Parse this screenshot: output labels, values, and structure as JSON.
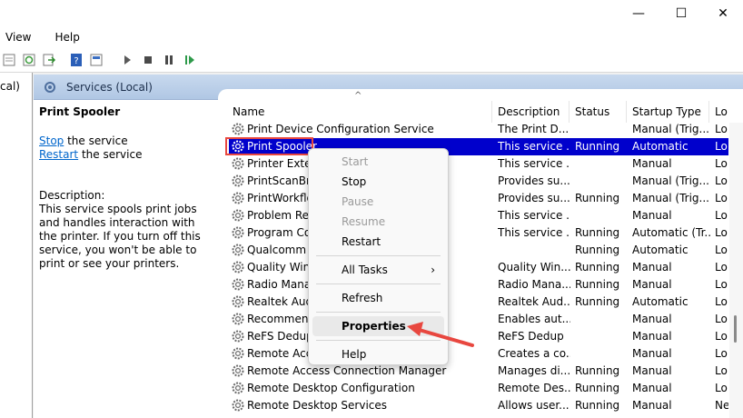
{
  "window": {
    "minimize": "—",
    "maximize": "☐",
    "close": "✕"
  },
  "menu": [
    "View",
    "Help"
  ],
  "tree": {
    "label": "cal)"
  },
  "header": {
    "title": "Services (Local)"
  },
  "extended": {
    "title": "Print Spooler",
    "stop_link": "Stop",
    "stop_rest": " the service",
    "restart_link": "Restart",
    "restart_rest": " the service",
    "desc_label": "Description:",
    "desc_text": "This service spools print jobs and handles interaction with the printer. If you turn off this service, you won't be able to print or see your printers."
  },
  "columns": [
    "Name",
    "Description",
    "Status",
    "Startup Type",
    "Lo"
  ],
  "rows": [
    {
      "name": "Print Device Configuration Service",
      "desc": "The Print D...",
      "status": "",
      "startup": "Manual (Trig...",
      "logon": "Lo"
    },
    {
      "name": "Print Spooler",
      "desc": "This service ...",
      "status": "Running",
      "startup": "Automatic",
      "logon": "Lo"
    },
    {
      "name": "Printer Exten",
      "desc": "This service ...",
      "status": "",
      "startup": "Manual",
      "logon": "Lo"
    },
    {
      "name": "PrintScanBro",
      "desc": "Provides su...",
      "status": "",
      "startup": "Manual (Trig...",
      "logon": "Lo"
    },
    {
      "name": "PrintWorkflo",
      "desc": "Provides su...",
      "status": "Running",
      "startup": "Manual (Trig...",
      "logon": "Lo"
    },
    {
      "name": "Problem Rep",
      "desc": "This service ...",
      "status": "",
      "startup": "Manual",
      "logon": "Lo"
    },
    {
      "name": "Program Co",
      "desc": "This service ...",
      "status": "Running",
      "startup": "Automatic (Tr...",
      "logon": "Lo"
    },
    {
      "name": "Qualcomm A",
      "desc": "",
      "status": "Running",
      "startup": "Automatic",
      "logon": "Lo"
    },
    {
      "name": "Quality Wind",
      "desc": "Quality Win...",
      "status": "Running",
      "startup": "Manual",
      "logon": "Lo"
    },
    {
      "name": "Radio Manag",
      "desc": "Radio Mana...",
      "status": "Running",
      "startup": "Manual",
      "logon": "Lo"
    },
    {
      "name": "Realtek Audi",
      "desc": "Realtek Aud...",
      "status": "Running",
      "startup": "Automatic",
      "logon": "Lo"
    },
    {
      "name": "Recommenc",
      "desc": "Enables aut...",
      "status": "",
      "startup": "Manual",
      "logon": "Lo"
    },
    {
      "name": "ReFS Dedup",
      "desc": "ReFS Dedup",
      "status": "",
      "startup": "Manual",
      "logon": "Lo"
    },
    {
      "name": "Remote Acce",
      "desc": "Creates a co...",
      "status": "",
      "startup": "Manual",
      "logon": "Lo"
    },
    {
      "name": "Remote Access Connection Manager",
      "desc": "Manages di...",
      "status": "Running",
      "startup": "Manual",
      "logon": "Lo"
    },
    {
      "name": "Remote Desktop Configuration",
      "desc": "Remote Des...",
      "status": "Running",
      "startup": "Manual",
      "logon": "Lo"
    },
    {
      "name": "Remote Desktop Services",
      "desc": "Allows user...",
      "status": "Running",
      "startup": "Manual",
      "logon": "Ne"
    }
  ],
  "context_menu": {
    "start": "Start",
    "stop": "Stop",
    "pause": "Pause",
    "resume": "Resume",
    "restart": "Restart",
    "all_tasks": "All Tasks",
    "refresh": "Refresh",
    "properties": "Properties",
    "help": "Help"
  },
  "colors": {
    "selection": "#0000cc",
    "highlight_box": "#e8473f",
    "link": "#0066cc"
  }
}
